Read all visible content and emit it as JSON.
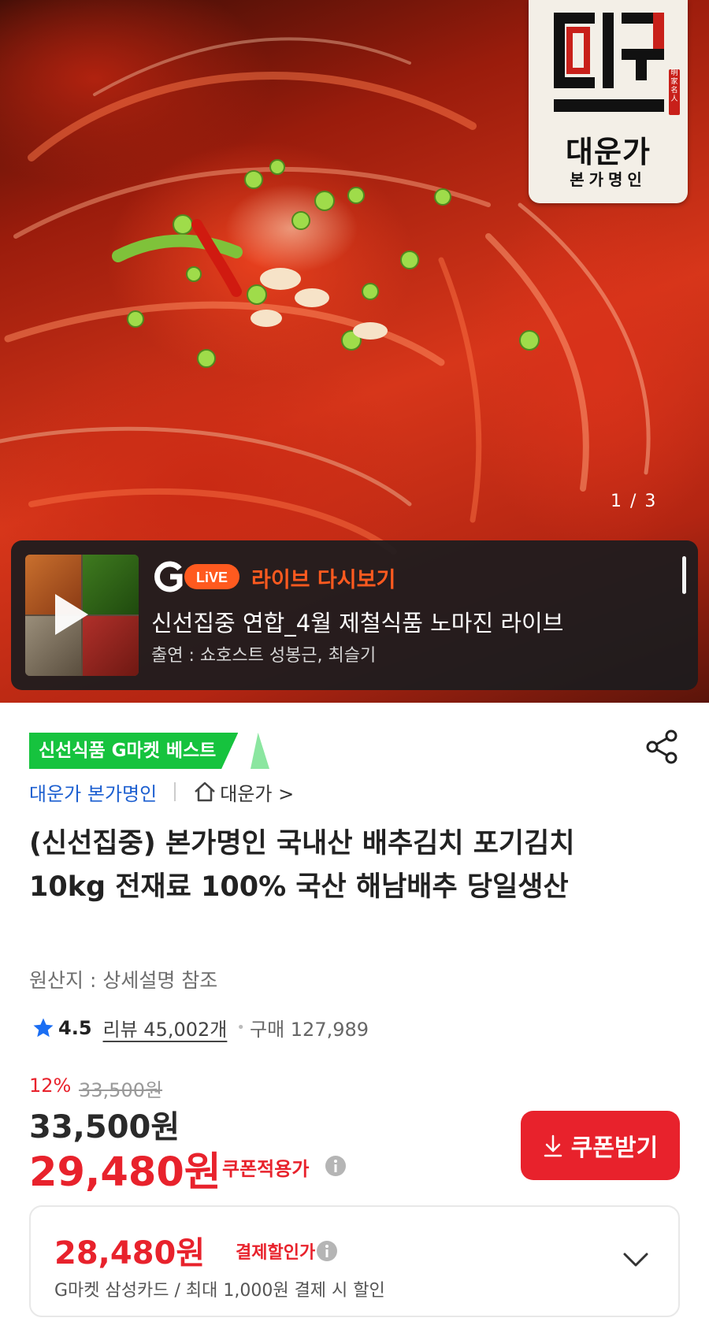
{
  "hero": {
    "brand_logo": {
      "mark_text": "대운",
      "seal_text": "明家名人",
      "name": "대운가",
      "subtitle": "본가명인"
    },
    "pager": "1 / 3"
  },
  "live": {
    "brand_icon": "g-live-logo",
    "label": "라이브 다시보기",
    "title": "신선집중 연합_4월 제철식품 노마진 라이브",
    "cast": "출연 : 쇼호스트 성봉근, 최슬기"
  },
  "product": {
    "badge": "신선식품 G마켓 베스트",
    "seller": "대운가 본가명인",
    "store_link": "대운가 >",
    "title": "(신선집중) 본가명인 국내산 배추김치 포기김치 10kg 전재료 100% 국산 해남배추 당일생산",
    "origin": "원산지 : 상세설명 참조",
    "rating": "4.5",
    "reviews": "리뷰 45,002개",
    "purchases": "구매 127,989"
  },
  "pricing": {
    "discount_rate": "12%",
    "original_price": "33,500원",
    "price": "33,500원",
    "coupon_price": "29,480원",
    "coupon_label": "쿠폰적용가",
    "coupon_button": "쿠폰받기"
  },
  "payment": {
    "price": "28,480원",
    "label": "결제할인가",
    "note": "G마켓 삼성카드 / 최대 1,000원 결제 시 할인"
  },
  "colors": {
    "accent_red": "#e8222c",
    "badge_green": "#16c33e",
    "link_blue": "#1c5fd0",
    "live_orange": "#ff5a1f"
  }
}
